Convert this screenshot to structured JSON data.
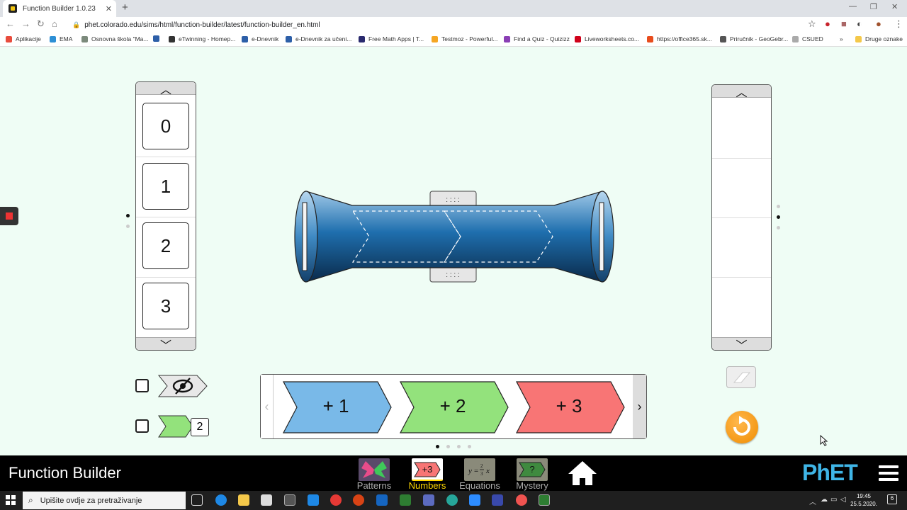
{
  "browser": {
    "tab_title": "Function Builder 1.0.23",
    "tab_close": "✕",
    "new_tab": "+",
    "url": "phet.colorado.edu/sims/html/function-builder/latest/function-builder_en.html",
    "window_controls": [
      "—",
      "❐",
      "✕"
    ]
  },
  "bookmarks": {
    "items": [
      {
        "label": "Aplikacije",
        "color": "#e84c3d"
      },
      {
        "label": "EMA",
        "color": "#2d8fd5"
      },
      {
        "label": "Osnovna škola \"Ma...",
        "color": "#7c8a7c"
      },
      {
        "label": "",
        "color": "#2d5fa8"
      },
      {
        "label": "eTwinning - Homep...",
        "color": "#333333"
      },
      {
        "label": "e-Dnevnik",
        "color": "#2d5fa8"
      },
      {
        "label": "e-Dnevnik za učeni...",
        "color": "#2d5fa8"
      },
      {
        "label": "Free Math Apps | T...",
        "color": "#2a2a6e"
      },
      {
        "label": "Testmoz - Powerful...",
        "color": "#f5a623"
      },
      {
        "label": "Find a Quiz - Quizizz",
        "color": "#8a3fb5"
      },
      {
        "label": "Liveworksheets.co...",
        "color": "#d0021b"
      },
      {
        "label": "https://office365.sk...",
        "color": "#e84c1d"
      },
      {
        "label": "Priručnik - GeoGebr...",
        "color": "#555555"
      },
      {
        "label": "CSUED",
        "color": "#aaaaaa"
      }
    ],
    "overflow": "»",
    "other": "Druge oznake"
  },
  "input_carousel": {
    "cards": [
      "0",
      "1",
      "2",
      "3"
    ],
    "up_arrow": "︿",
    "down_arrow": "﹀"
  },
  "output_carousel": {
    "up_arrow": "︿",
    "down_arrow": "﹀"
  },
  "function_carousel": {
    "left_arrow": "‹",
    "right_arrow": "›",
    "functions": [
      {
        "label": "+ 1",
        "color": "#79b9e8"
      },
      {
        "label": "+ 2",
        "color": "#93e27c"
      },
      {
        "label": "+ 3",
        "color": "#f87575"
      }
    ]
  },
  "options": {
    "hide_functions_checked": false,
    "duplicate_count": "2"
  },
  "navbar": {
    "title": "Function Builder",
    "screens": [
      {
        "label": "Patterns",
        "active": false
      },
      {
        "label": "Numbers",
        "active": true,
        "icon_text": "+3"
      },
      {
        "label": "Equations",
        "active": false
      },
      {
        "label": "Mystery",
        "active": false,
        "icon_text": "?"
      }
    ],
    "logo": "PhET"
  },
  "taskbar": {
    "search_placeholder": "Upišite ovdje za pretraživanje",
    "time": "19:45",
    "date": "25.5.2020.",
    "notifications": "6"
  },
  "colors": {
    "sim_background": "#effdf5",
    "builder_blue": "#1f6fae",
    "reset_orange": "#f08c00",
    "active_screen": "#ffd700"
  }
}
